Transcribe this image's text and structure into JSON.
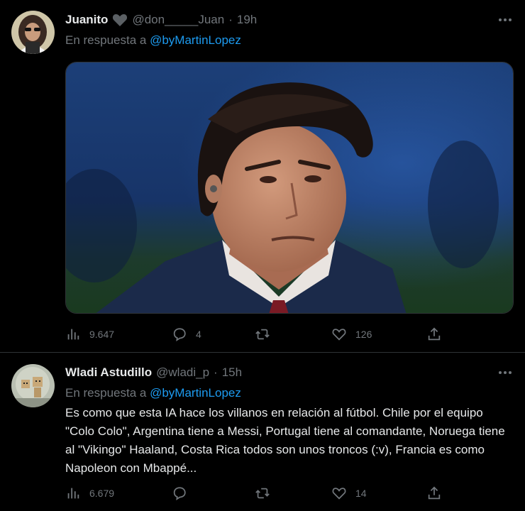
{
  "colors": {
    "background": "#000000",
    "text": "#e7e9ea",
    "muted": "#71767b",
    "link": "#1d9bf0",
    "divider": "#2f3336"
  },
  "tweets": [
    {
      "display_name": "Juanito",
      "badge_icon": "heart-icon",
      "handle": "@don_____Juan",
      "separator": "·",
      "time": "19h",
      "reply_prefix": "En respuesta a",
      "reply_mention": "@byMartinLopez",
      "text": "",
      "stats": {
        "views": "9.647",
        "replies": "4",
        "retweets": "",
        "likes": "126"
      }
    },
    {
      "display_name": "Wladi Astudillo",
      "handle": "@wladi_p",
      "separator": "·",
      "time": "15h",
      "reply_prefix": "En respuesta a",
      "reply_mention": "@byMartinLopez",
      "text": "Es como que esta IA hace los villanos en relación al fútbol. Chile por el equipo \"Colo Colo\", Argentina tiene a Messi, Portugal tiene al comandante, Noruega tiene al \"Vikingo\" Haaland, Costa Rica todos son unos troncos (:v), Francia es como Napoleon con Mbappé...",
      "stats": {
        "views": "6.679",
        "replies": "",
        "retweets": "",
        "likes": "14"
      }
    }
  ]
}
